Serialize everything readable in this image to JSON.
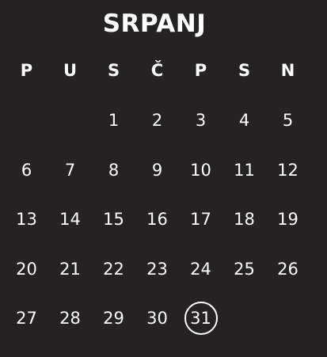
{
  "calendar": {
    "month_title": "SRPANJ",
    "weekdays": [
      "P",
      "U",
      "S",
      "Č",
      "P",
      "S",
      "N"
    ],
    "weeks": [
      [
        "",
        "",
        "1",
        "2",
        "3",
        "4",
        "5"
      ],
      [
        "6",
        "7",
        "8",
        "9",
        "10",
        "11",
        "12"
      ],
      [
        "13",
        "14",
        "15",
        "16",
        "17",
        "18",
        "19"
      ],
      [
        "20",
        "21",
        "22",
        "23",
        "24",
        "25",
        "26"
      ],
      [
        "27",
        "28",
        "29",
        "30",
        "31",
        "",
        ""
      ]
    ],
    "selected_day": "31"
  },
  "colors": {
    "background": "#252223",
    "text": "#ffffff",
    "selection_ring": "#ffffff"
  }
}
